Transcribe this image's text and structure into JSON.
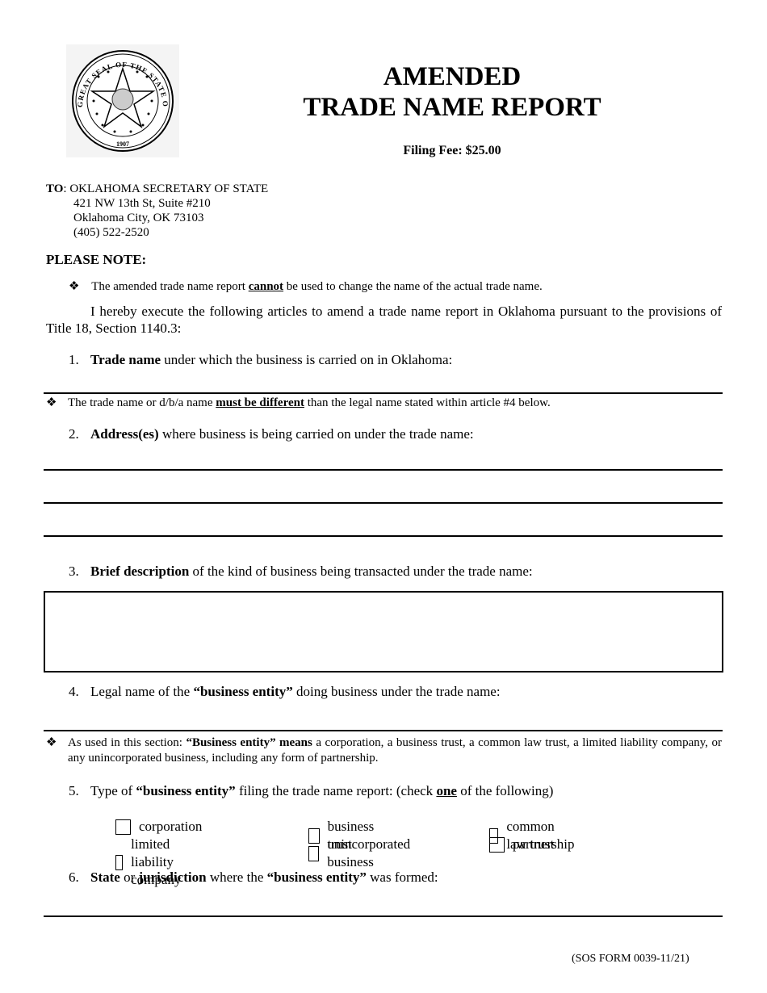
{
  "header": {
    "seal": {
      "outer_text": "GREAT SEAL OF THE STATE OF OKLAHOMA",
      "year": "1907"
    },
    "title_line1": "AMENDED",
    "title_line2": "TRADE NAME REPORT",
    "filing_fee": "Filing Fee: $25.00"
  },
  "to_block": {
    "label": "TO",
    "recipient": ": OKLAHOMA SECRETARY OF STATE",
    "address1": "421 NW 13th St, Suite #210",
    "address2": "Oklahoma City, OK 73103",
    "phone": "(405) 522-2520"
  },
  "please_note": {
    "heading": "PLEASE NOTE:",
    "bullet_pre": "The amended trade name report ",
    "bullet_emph": "cannot",
    "bullet_post": " be used to change the name of the actual trade name."
  },
  "intro": "I hereby execute the following articles to amend a trade name report in Oklahoma pursuant to the provisions of Title 18, Section 1140.3:",
  "items": [
    {
      "num": "1.",
      "bold": "Trade name",
      "rest": " under which the business is carried on in Oklahoma:"
    },
    {
      "num": "2.",
      "bold": "Address(es)",
      "rest": " where business is being carried on under the trade name:"
    },
    {
      "num": "3.",
      "bold": "Brief description",
      "rest": " of the kind of business being transacted under the trade name:"
    },
    {
      "num": "4.",
      "pre": "Legal name of the ",
      "bold": "“business entity”",
      "rest": " doing business under the trade name:"
    },
    {
      "num": "5.",
      "pre": "Type of ",
      "bold": "“business entity”",
      "mid": " filing the trade name report: (check ",
      "emph": "one",
      "rest": " of the following)"
    },
    {
      "num": "6.",
      "bold1": "State",
      "or": " or ",
      "bold2": "jurisdiction",
      "mid": " where the ",
      "bold3": "“business entity”",
      "rest": " was formed:"
    }
  ],
  "note_trade_name": {
    "pre": "The trade name or d/b/a name ",
    "emph": "must be different",
    "post": " than the legal name stated within article #4 below."
  },
  "note_entity": {
    "pre": "As used in this section: ",
    "bold": "“Business entity” means",
    "post": " a corporation, a business trust, a common law trust, a limited liability company, or any unincorporated business, including any form of partnership."
  },
  "fields": {
    "trade_name": "",
    "address_line1": "",
    "address_line2": "",
    "address_line3": "",
    "description": "",
    "legal_name": "",
    "state_jurisdiction": ""
  },
  "entity_types": [
    {
      "label": "corporation",
      "checked": false
    },
    {
      "label": "business trust",
      "checked": false
    },
    {
      "label": "common law trust",
      "checked": false
    },
    {
      "label": "limited liability company",
      "checked": false
    },
    {
      "label": "unincorporated business",
      "checked": false
    },
    {
      "label": "partnership",
      "checked": false
    }
  ],
  "footer": "(SOS FORM 0039-11/21)",
  "bullet_icon": "diamond-bullet-icon"
}
